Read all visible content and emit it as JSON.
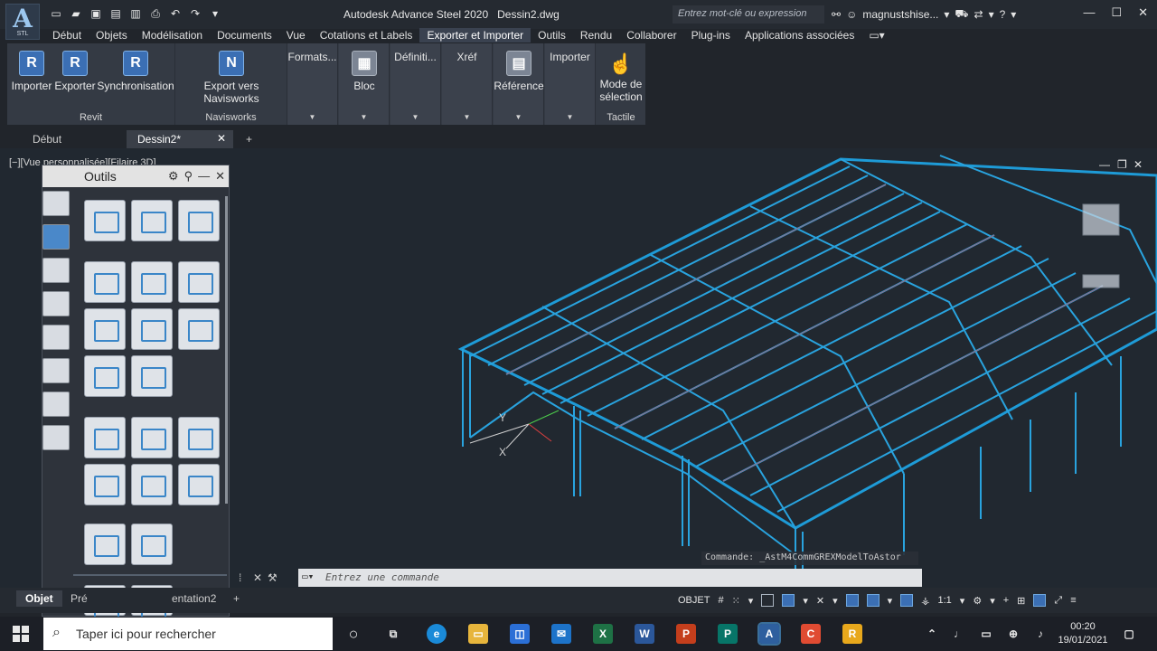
{
  "app": {
    "logo_letter": "A",
    "logo_sub": "STL",
    "window_title": "Autodesk Advance Steel 2020",
    "doc_title": "Dessin2.dwg",
    "search_placeholder": "Entrez mot-clé ou expression",
    "user": "magnustshise...",
    "accent": "#1e9bd7"
  },
  "menu": {
    "tabs": [
      "Début",
      "Objets",
      "Modélisation",
      "Documents",
      "Vue",
      "Cotations et Labels",
      "Exporter et Importer",
      "Outils",
      "Rendu",
      "Collaborer",
      "Plug-ins",
      "Applications associées"
    ],
    "active": "Exporter et Importer"
  },
  "ribbon": {
    "revit": {
      "import": "Importer",
      "export": "Exporter",
      "sync": "Synchronisation",
      "title": "Revit"
    },
    "navisworks": {
      "export": "Export vers Navisworks",
      "title": "Navisworks"
    },
    "formats": "Formats...",
    "bloc": "Bloc",
    "definition": "Définiti...",
    "xref": "Xréf",
    "reference": "Référence",
    "import": "Importer",
    "selection_mode_1": "Mode de",
    "selection_mode_2": "sélection",
    "tactile": "Tactile"
  },
  "doctabs": {
    "home": "Début",
    "current": "Dessin2*"
  },
  "viewport": {
    "label": "[−][Vue personnalisée][Filaire 3D]"
  },
  "palette": {
    "title": "Outils"
  },
  "command": {
    "history": "Commande: _AstM4CommGREXModelToAstor",
    "placeholder": "Entrez une commande"
  },
  "layout": {
    "model": "Objet",
    "pres1": "Pré",
    "pres2": "entation2"
  },
  "status": {
    "mode": "OBJET",
    "scale": "1:1"
  },
  "taskbar": {
    "search": "Taper ici pour rechercher",
    "time": "00:20",
    "date": "19/01/2021"
  }
}
